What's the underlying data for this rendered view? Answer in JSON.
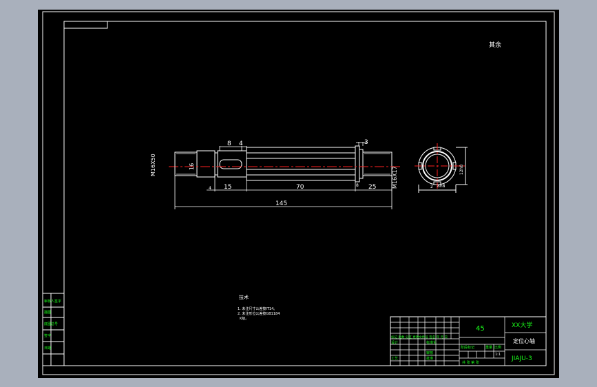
{
  "drawing": {
    "roughness_note": "其余",
    "dimensions": {
      "thread_left": "M16X50",
      "dia_left": "16",
      "slot_width": "8",
      "slot_offset": "4",
      "groove_small": "3",
      "len_15": "15",
      "len_70": "70",
      "len_25": "25",
      "len_4": "4",
      "len_8": "8",
      "total_length": "145",
      "thread_right": "M16X17",
      "section_dim_a": "8h8",
      "section_dim_b": "12h8",
      "section_dim_c": "2"
    },
    "notes": {
      "title": "技术",
      "line1": "1. 未注尺寸公差按IT14。",
      "line2": "2. 未注形位公差按GB1184",
      "line3": "K级。"
    }
  },
  "side_block": {
    "cells": [
      "审核人签字",
      "描图",
      "底图总号",
      "签字",
      "日期"
    ]
  },
  "title_block": {
    "material": "45",
    "school": "XX大学",
    "part_name": "定位心轴",
    "drawing_no": "JIAJU-3",
    "header_cells": "标记 处数 分区 更改文件号 签名 年 月 日",
    "row_design": "设计",
    "row_check": "审核",
    "row_process": "工艺",
    "row_standard": "标准化",
    "row_approve": "批准",
    "stage_label": "阶段标记",
    "weight_label": "重量",
    "scale_label": "比例",
    "scale_value": "1:1",
    "sheet_label": "共 张 第 张"
  }
}
